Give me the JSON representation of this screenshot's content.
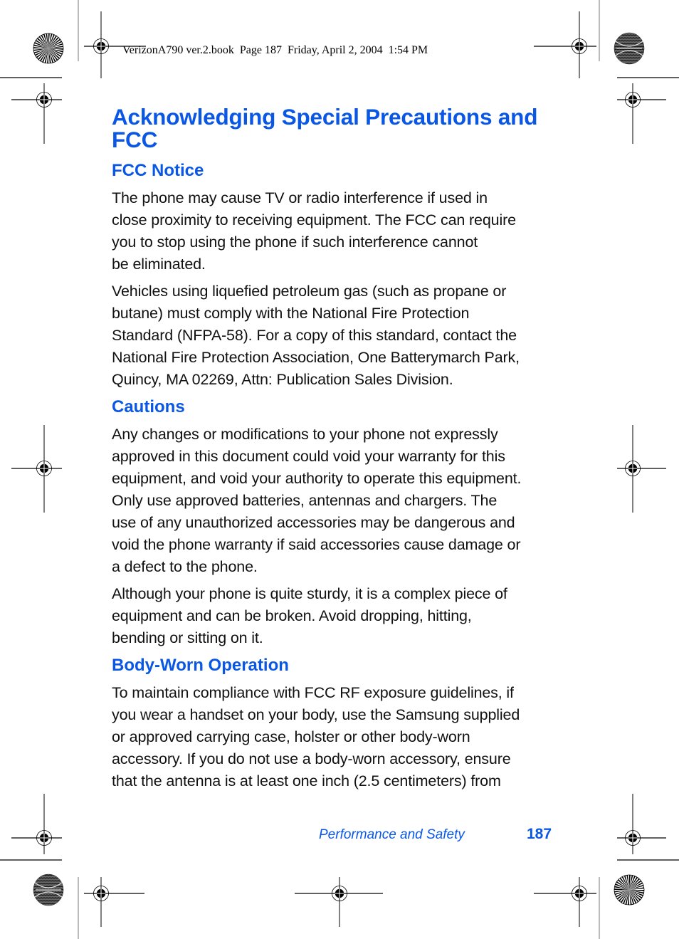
{
  "running_head": "VerizonA790 ver.2.book  Page 187  Friday, April 2, 2004  1:54 PM",
  "title": "Acknowledging Special Precautions and FCC",
  "title_lines": [
    "Acknowledging Special Precautions and",
    "FCC"
  ],
  "sections": [
    {
      "heading": "FCC Notice",
      "paragraphs": [
        "The phone may cause TV or radio interference if used in\nclose proximity to receiving equipment. The FCC can require\nyou to stop using the phone if such interference cannot\nbe eliminated.",
        "Vehicles using liquefied petroleum gas (such as propane or\nbutane) must comply with the National Fire Protection\nStandard (NFPA-58). For a copy of this standard, contact the\nNational Fire Protection Association, One Batterymarch Park,\nQuincy, MA 02269, Attn: Publication Sales Division."
      ]
    },
    {
      "heading": "Cautions",
      "paragraphs": [
        "Any changes or modifications to your phone not expressly\napproved in this document could void your warranty for this\nequipment, and void your authority to operate this equipment.\nOnly use approved batteries, antennas and chargers. The\nuse of any unauthorized accessories may be dangerous and\nvoid the phone warranty if said accessories cause damage or\na defect to the phone.",
        "Although your phone is quite sturdy, it is a complex piece of\nequipment and can be broken. Avoid dropping, hitting,\nbending or sitting on it."
      ]
    },
    {
      "heading": "Body-Worn Operation",
      "paragraphs": [
        "To maintain compliance with FCC RF exposure guidelines, if\nyou wear a handset on your body, use the Samsung supplied\nor approved carrying case, holster or other body-worn\naccessory. If you do not use a body-worn accessory, ensure\nthat the antenna is at least one inch (2.5 centimeters) from"
      ]
    }
  ],
  "footer": {
    "section_name": "Performance and Safety",
    "page_number": "187"
  },
  "colors": {
    "heading_blue": "#0a57e6",
    "body_text": "#111111"
  },
  "icons": {
    "registration_mark": "registration-crosshair-icon",
    "color_bar_starburst": "starburst-target-icon",
    "color_bar_moire": "moire-target-icon"
  }
}
